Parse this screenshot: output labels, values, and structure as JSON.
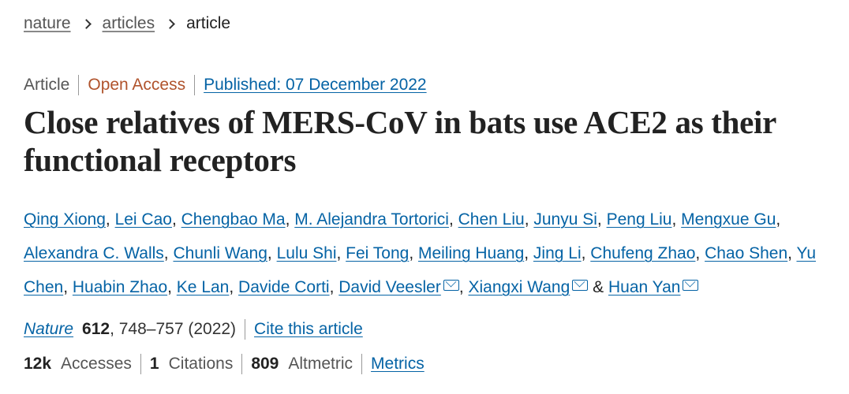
{
  "breadcrumb": {
    "items": [
      "nature",
      "articles"
    ],
    "current": "article"
  },
  "meta": {
    "type": "Article",
    "access": "Open Access",
    "published": "Published: 07 December 2022"
  },
  "title": "Close relatives of MERS-CoV in bats use ACE2 as their functional receptors",
  "authors": [
    {
      "name": "Qing Xiong",
      "mail": false
    },
    {
      "name": "Lei Cao",
      "mail": false
    },
    {
      "name": "Chengbao Ma",
      "mail": false
    },
    {
      "name": "M. Alejandra Tortorici",
      "mail": false
    },
    {
      "name": "Chen Liu",
      "mail": false
    },
    {
      "name": "Junyu Si",
      "mail": false
    },
    {
      "name": "Peng Liu",
      "mail": false
    },
    {
      "name": "Mengxue Gu",
      "mail": false
    },
    {
      "name": "Alexandra C. Walls",
      "mail": false
    },
    {
      "name": "Chunli Wang",
      "mail": false
    },
    {
      "name": "Lulu Shi",
      "mail": false
    },
    {
      "name": "Fei Tong",
      "mail": false
    },
    {
      "name": "Meiling Huang",
      "mail": false
    },
    {
      "name": "Jing Li",
      "mail": false
    },
    {
      "name": "Chufeng Zhao",
      "mail": false
    },
    {
      "name": "Chao Shen",
      "mail": false
    },
    {
      "name": "Yu Chen",
      "mail": false
    },
    {
      "name": "Huabin Zhao",
      "mail": false
    },
    {
      "name": "Ke Lan",
      "mail": false
    },
    {
      "name": "Davide Corti",
      "mail": false
    },
    {
      "name": "David Veesler",
      "mail": true
    },
    {
      "name": "Xiangxi Wang",
      "mail": true
    },
    {
      "name": "Huan Yan",
      "mail": true
    }
  ],
  "author_separator": ", ",
  "author_last_separator": " & ",
  "citation": {
    "journal": "Nature",
    "volume": "612",
    "pages_year": ", 748–757 (2022)",
    "cite_link": "Cite this article"
  },
  "metrics": {
    "accesses_value": "12k",
    "accesses_label": "Accesses",
    "citations_value": "1",
    "citations_label": "Citations",
    "altmetric_value": "809",
    "altmetric_label": "Altmetric",
    "metrics_link": "Metrics"
  },
  "colors": {
    "link": "#0563a5",
    "open_access": "#b0532c",
    "text": "#222222"
  },
  "icons": {
    "breadcrumb_separator": "chevron-right-icon",
    "author_contact": "envelope-icon"
  }
}
